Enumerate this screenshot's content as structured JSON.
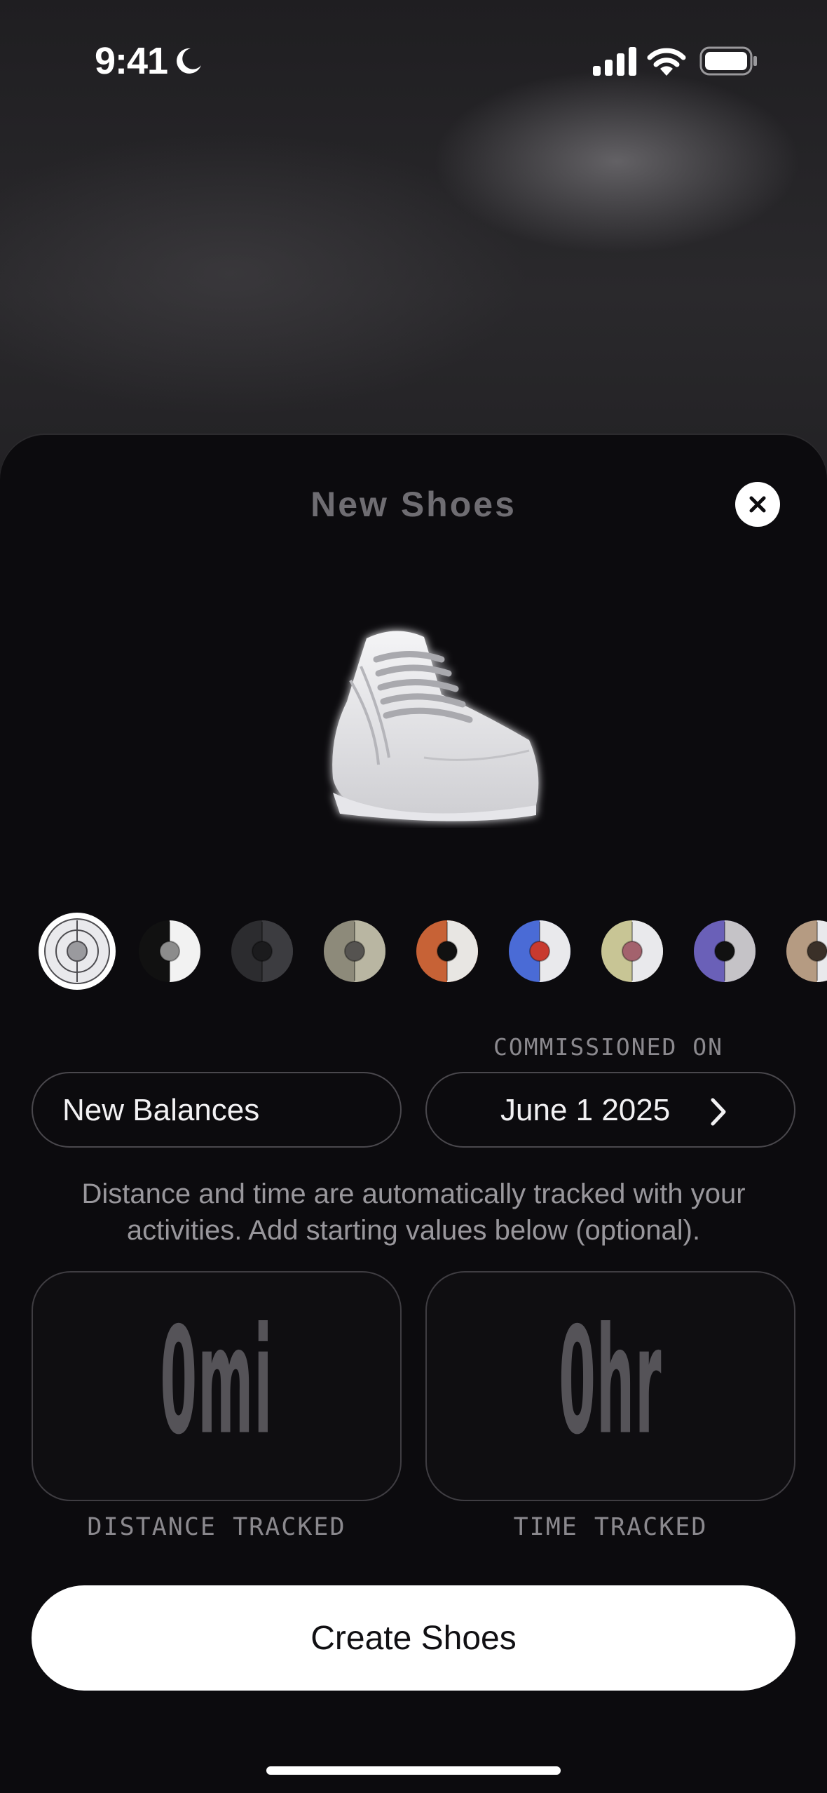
{
  "status_bar": {
    "time": "9:41",
    "icons": [
      "moon-icon",
      "cellular-signal-icon",
      "wifi-icon",
      "battery-icon"
    ]
  },
  "sheet": {
    "title": "New Shoes",
    "close_icon": "close-icon"
  },
  "shoe_image": "white-sneaker-illustration",
  "color_swatches": [
    {
      "name": "white",
      "selected": true,
      "colors": [
        "#e9e9ec",
        "#c9c9cd",
        "#9a9a9e"
      ]
    },
    {
      "name": "black-white",
      "selected": false,
      "colors": [
        "#111111",
        "#f2f2f2",
        "#8c8c8c"
      ]
    },
    {
      "name": "charcoal",
      "selected": false,
      "colors": [
        "#2c2c2f",
        "#3c3c40",
        "#1b1b1d"
      ]
    },
    {
      "name": "sand-grey",
      "selected": false,
      "colors": [
        "#8d8a7a",
        "#b9b6a2",
        "#555350"
      ]
    },
    {
      "name": "orange",
      "selected": false,
      "colors": [
        "#c76236",
        "#e8e6e3",
        "#111111"
      ]
    },
    {
      "name": "blue-red",
      "selected": false,
      "colors": [
        "#4a6bd6",
        "#e9e9ec",
        "#c83a2f"
      ]
    },
    {
      "name": "olive-mauve",
      "selected": false,
      "colors": [
        "#c8c595",
        "#e9e9ec",
        "#a3626d"
      ]
    },
    {
      "name": "purple-grey",
      "selected": false,
      "colors": [
        "#6a60b8",
        "#c5c3c7",
        "#111111"
      ]
    },
    {
      "name": "tan",
      "selected": false,
      "colors": [
        "#b59b82",
        "#e9e9ec",
        "#3a3028"
      ]
    }
  ],
  "form": {
    "commissioned_label": "COMMISSIONED ON",
    "name_value": "New Balances",
    "date_value": "June 1 2025",
    "helper_text": "Distance and time are automatically tracked with your activities. Add starting values below (optional)."
  },
  "stats": {
    "distance_value": "0mi",
    "distance_caption": "DISTANCE TRACKED",
    "time_value": "0hr",
    "time_caption": "TIME TRACKED"
  },
  "actions": {
    "create_label": "Create Shoes"
  }
}
